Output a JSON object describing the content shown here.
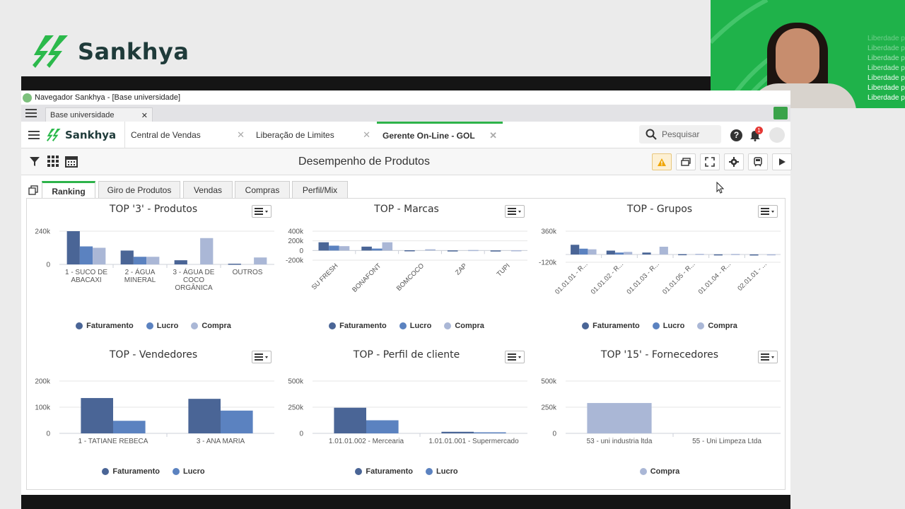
{
  "brand": {
    "name": "Sankhya"
  },
  "video": {
    "watermark_lines": [
      "Liberdade p",
      "Liberdade p",
      "Liberdade p",
      "Liberdade p",
      "Liberdade p",
      "Liberdade p",
      "Liberdade p"
    ]
  },
  "window": {
    "title": "Navegador Sankhya - [Base universidade]"
  },
  "browser_tab": {
    "label": "Base universidade"
  },
  "app_tabs": [
    {
      "label": "Central de Vendas"
    },
    {
      "label": "Liberação de Limites"
    },
    {
      "label": "Gerente On-Line - GOL"
    }
  ],
  "search": {
    "placeholder": "Pesquisar"
  },
  "notifications": {
    "count": "1"
  },
  "page": {
    "title": "Desempenho de Produtos"
  },
  "page_tabs": [
    {
      "label": "Ranking"
    },
    {
      "label": "Giro de Produtos"
    },
    {
      "label": "Vendas"
    },
    {
      "label": "Compras"
    },
    {
      "label": "Perfil/Mix"
    }
  ],
  "colors": {
    "faturamento": "#4a6596",
    "lucro": "#5b82c0",
    "compra": "#aab7d6",
    "accent": "#2db34a"
  },
  "chart_data": [
    {
      "type": "bar",
      "title": "TOP '3' - Produtos",
      "categories": [
        "1 - SUCO DE ABACAXI",
        "2 - ÁGUA MINERAL",
        "3 - ÁGUA DE COCO ORGÂNICA",
        "OUTROS"
      ],
      "category_lines": [
        [
          "1 - SUCO DE",
          "ABACAXI"
        ],
        [
          "2 - ÁGUA",
          "MINERAL"
        ],
        [
          "3 - ÁGUA DE",
          "COCO",
          "ORGÂNICA"
        ],
        [
          "OUTROS"
        ]
      ],
      "series": [
        {
          "name": "Faturamento",
          "values": [
            240000,
            100000,
            30000,
            5000
          ]
        },
        {
          "name": "Lucro",
          "values": [
            130000,
            55000,
            0,
            0
          ]
        },
        {
          "name": "Compra",
          "values": [
            120000,
            55000,
            190000,
            50000
          ]
        }
      ],
      "ylim": [
        0,
        240000
      ],
      "yticks": [
        {
          "v": 240000,
          "label": "240k"
        },
        {
          "v": 0,
          "label": "0"
        }
      ],
      "rotate": false
    },
    {
      "type": "bar",
      "title": "TOP - Marcas",
      "categories": [
        "SU FRESH",
        "BONAFONT",
        "BOMCOCO",
        "ZAP",
        "TUPI"
      ],
      "series": [
        {
          "name": "Faturamento",
          "values": [
            170000,
            80000,
            5000,
            2000,
            1000
          ]
        },
        {
          "name": "Lucro",
          "values": [
            100000,
            40000,
            0,
            0,
            0
          ]
        },
        {
          "name": "Compra",
          "values": [
            90000,
            170000,
            25000,
            10000,
            5000
          ]
        }
      ],
      "ylim": [
        -200000,
        400000
      ],
      "yticks": [
        {
          "v": 400000,
          "label": "400k"
        },
        {
          "v": 200000,
          "label": "200k"
        },
        {
          "v": 0,
          "label": "0"
        },
        {
          "v": -200000,
          "label": "-200k"
        }
      ],
      "rotate": true
    },
    {
      "type": "bar",
      "title": "TOP - Grupos",
      "categories": [
        "01.01.01 - R...",
        "01.01.02 - R...",
        "01.01.03 - R...",
        "01.01.05 - R...",
        "01.01.04 - R...",
        "02.01.01 - ..."
      ],
      "series": [
        {
          "name": "Faturamento",
          "values": [
            150000,
            60000,
            30000,
            5000,
            2000,
            1000
          ]
        },
        {
          "name": "Lucro",
          "values": [
            90000,
            30000,
            0,
            0,
            0,
            0
          ]
        },
        {
          "name": "Compra",
          "values": [
            80000,
            40000,
            120000,
            10000,
            8000,
            3000
          ]
        }
      ],
      "ylim": [
        -120000,
        360000
      ],
      "yticks": [
        {
          "v": 360000,
          "label": "360k"
        },
        {
          "v": -120000,
          "label": "-120k"
        }
      ],
      "rotate": true
    },
    {
      "type": "bar",
      "title": "TOP - Vendedores",
      "categories": [
        "1 - TATIANE REBECA",
        "3 - ANA MARIA"
      ],
      "series": [
        {
          "name": "Faturamento",
          "values": [
            135000,
            132000
          ]
        },
        {
          "name": "Lucro",
          "values": [
            48000,
            87000
          ]
        }
      ],
      "ylim": [
        0,
        200000
      ],
      "yticks": [
        {
          "v": 200000,
          "label": "200k"
        },
        {
          "v": 100000,
          "label": "100k"
        },
        {
          "v": 0,
          "label": "0"
        }
      ],
      "rotate": false
    },
    {
      "type": "bar",
      "title": "TOP - Perfil de cliente",
      "categories": [
        "1.01.01.002 - Mercearia",
        "1.01.01.001 - Supermercado"
      ],
      "series": [
        {
          "name": "Faturamento",
          "values": [
            245000,
            15000
          ]
        },
        {
          "name": "Lucro",
          "values": [
            125000,
            10000
          ]
        }
      ],
      "ylim": [
        0,
        500000
      ],
      "yticks": [
        {
          "v": 500000,
          "label": "500k"
        },
        {
          "v": 250000,
          "label": "250k"
        },
        {
          "v": 0,
          "label": "0"
        }
      ],
      "rotate": false
    },
    {
      "type": "bar",
      "title": "TOP '15' - Fornecedores",
      "categories": [
        "53 - uni industria ltda",
        "55 - Uni Limpeza Ltda"
      ],
      "series": [
        {
          "name": "Compra",
          "values": [
            290000,
            0
          ]
        }
      ],
      "ylim": [
        0,
        500000
      ],
      "yticks": [
        {
          "v": 500000,
          "label": "500k"
        },
        {
          "v": 250000,
          "label": "250k"
        },
        {
          "v": 0,
          "label": "0"
        }
      ],
      "rotate": false
    }
  ]
}
